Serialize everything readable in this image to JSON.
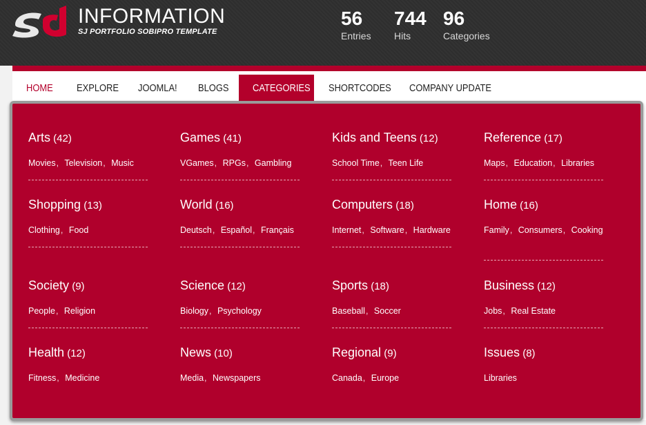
{
  "brand": {
    "title": "INFORMATION",
    "subtitle": "SJ PORTFOLIO SOBIPRO TEMPLATE"
  },
  "stats": [
    {
      "value": "56",
      "label": "Entries"
    },
    {
      "value": "744",
      "label": "Hits"
    },
    {
      "value": "96",
      "label": "Categories"
    }
  ],
  "nav": [
    "HOME",
    "EXPLORE",
    "JOOMLA!",
    "BLOGS",
    "CATEGORIES",
    "SHORTCODES",
    "COMPANY UPDATE"
  ],
  "colors": {
    "accent": "#b0002c",
    "header": "#2f2f2f"
  },
  "categories": [
    {
      "name": "Arts",
      "count": "(42)",
      "links": [
        "Movies",
        "Television",
        "Music"
      ]
    },
    {
      "name": "Games",
      "count": "(41)",
      "links": [
        "VGames",
        "RPGs",
        "Gambling"
      ]
    },
    {
      "name": "Kids and Teens",
      "count": "(12)",
      "links": [
        "School Time",
        "Teen Life"
      ]
    },
    {
      "name": "Reference",
      "count": "(17)",
      "links": [
        "Maps",
        "Education",
        "Libraries"
      ]
    },
    {
      "name": "Shopping",
      "count": "(13)",
      "links": [
        "Clothing",
        "Food"
      ]
    },
    {
      "name": "World",
      "count": "(16)",
      "links": [
        "Deutsch",
        "Español",
        "Français"
      ]
    },
    {
      "name": "Computers",
      "count": "(18)",
      "links": [
        "Internet",
        "Software",
        "Hardware"
      ]
    },
    {
      "name": "Home",
      "count": "(16)",
      "links": [
        "Family",
        "Consumers",
        "Cooking"
      ]
    },
    {
      "name": "Society",
      "count": "(9)",
      "links": [
        "People",
        "Religion"
      ]
    },
    {
      "name": "Science",
      "count": "(12)",
      "links": [
        "Biology",
        "Psychology"
      ]
    },
    {
      "name": "Sports",
      "count": "(18)",
      "links": [
        "Baseball",
        "Soccer"
      ]
    },
    {
      "name": "Business",
      "count": "(12)",
      "links": [
        "Jobs",
        "Real Estate"
      ]
    },
    {
      "name": "Health",
      "count": "(12)",
      "links": [
        "Fitness",
        "Medicine"
      ]
    },
    {
      "name": "News",
      "count": "(10)",
      "links": [
        "Media",
        "Newspapers"
      ]
    },
    {
      "name": "Regional",
      "count": "(9)",
      "links": [
        "Canada",
        "Europe"
      ]
    },
    {
      "name": "Issues",
      "count": "(8)",
      "links": [
        "Libraries"
      ]
    }
  ]
}
